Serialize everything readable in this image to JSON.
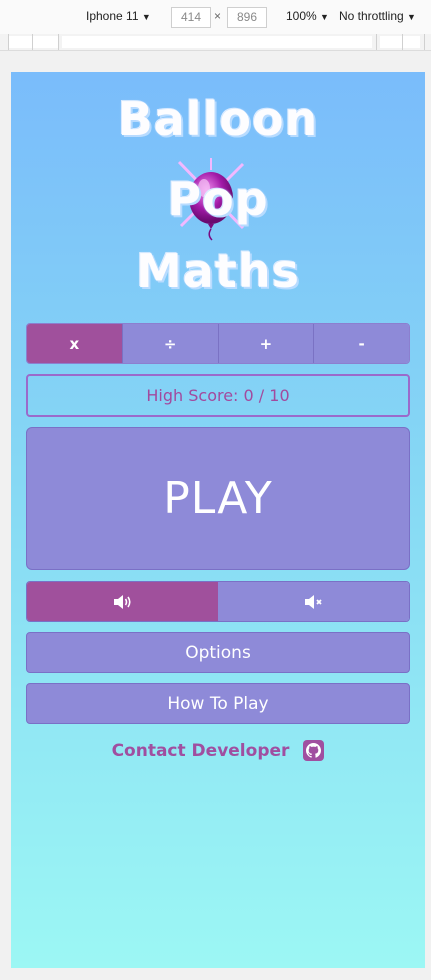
{
  "devtools": {
    "device": "Iphone 11",
    "width": "414",
    "times": "×",
    "height": "896",
    "zoom": "100%",
    "throttling": "No throttling",
    "caret": "▼"
  },
  "app": {
    "title_line1": "Balloon",
    "title_line2": "Pop",
    "title_line3": "Maths",
    "operations": [
      {
        "label": "x",
        "active": true
      },
      {
        "label": "÷",
        "active": false
      },
      {
        "label": "+",
        "active": false
      },
      {
        "label": "-",
        "active": false
      }
    ],
    "high_score": "High Score: 0 / 10",
    "play_label": "PLAY",
    "sound_on_icon": "speaker-on-icon",
    "sound_off_icon": "speaker-muted-icon",
    "options_label": "Options",
    "how_to_play_label": "How To Play",
    "contact_label": "Contact Developer",
    "contact_icon": "github-icon"
  },
  "colors": {
    "accent_active": "#a0509c",
    "button": "#8e8ad8",
    "text_accent": "#a24a9e",
    "bg_top": "#7abcfb",
    "bg_bottom": "#9cf7f4"
  }
}
